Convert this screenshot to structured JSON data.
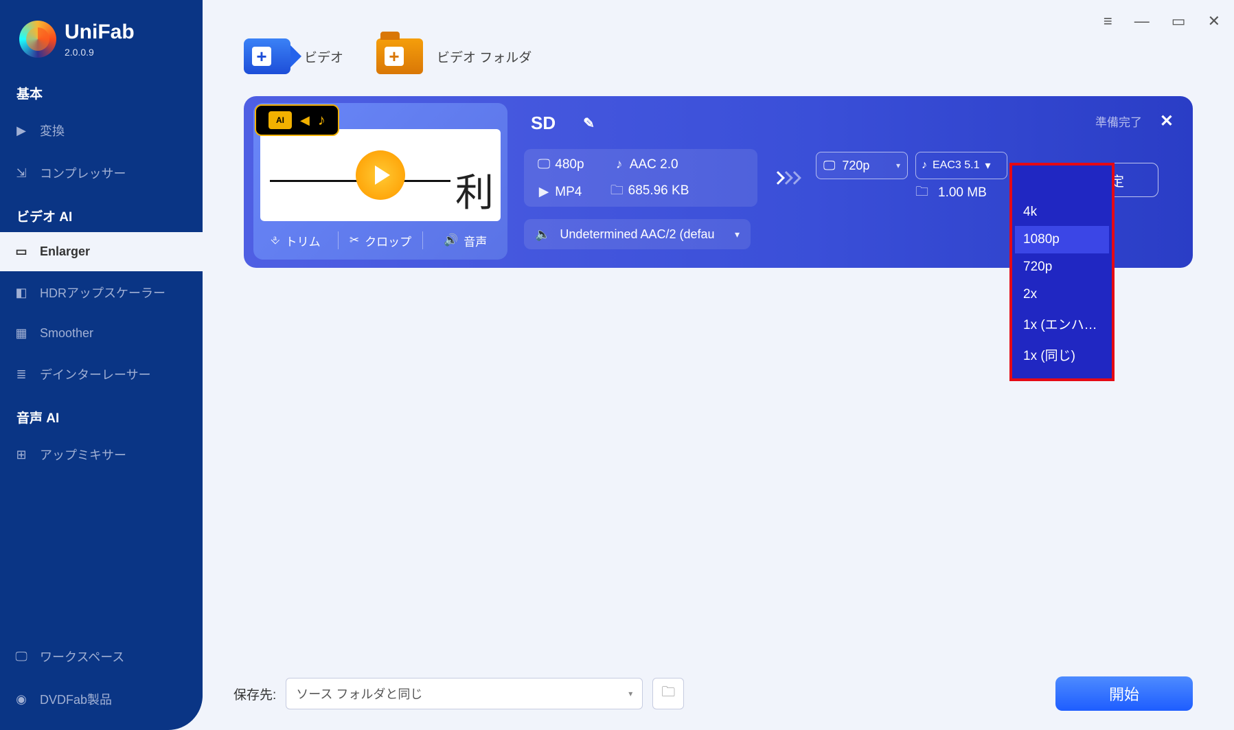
{
  "app": {
    "name": "UniFab",
    "version": "2.0.0.9"
  },
  "sidebar": {
    "basic_label": "基本",
    "basic": [
      {
        "label": "変換",
        "icon": "play-square"
      },
      {
        "label": "コンプレッサー",
        "icon": "compress"
      }
    ],
    "video_ai_label": "ビデオ AI",
    "video_ai": [
      {
        "label": "Enlarger",
        "icon": "enlarge"
      },
      {
        "label": "HDRアップスケーラー",
        "icon": "hdr"
      },
      {
        "label": "Smoother",
        "icon": "smoother"
      },
      {
        "label": "デインターレーサー",
        "icon": "deinterlace"
      }
    ],
    "audio_ai_label": "音声 AI",
    "audio_ai": [
      {
        "label": "アップミキサー",
        "icon": "upmix"
      }
    ],
    "bottom": [
      {
        "label": "ワークスペース",
        "icon": "workspace"
      },
      {
        "label": "DVDFab製品",
        "icon": "dvdfab"
      }
    ]
  },
  "addbar": {
    "video_label": "ビデオ",
    "folder_label": "ビデオ フォルダ"
  },
  "card": {
    "ai_badge": "AI",
    "tools": {
      "trim": "トリム",
      "crop": "クロップ",
      "audio": "音声"
    },
    "title": "SD",
    "status": "準備完了",
    "source": {
      "res": "480p",
      "audio": "AAC 2.0",
      "container": "MP4",
      "size": "685.96 KB"
    },
    "output": {
      "res_selected": "720p",
      "audio_selected": "EAC3 5.1",
      "size": "1.00 MB"
    },
    "audio_track": "Undetermined AAC/2 (defau",
    "settings_label": "設定",
    "res_options": [
      "4k",
      "1080p",
      "720p",
      "2x",
      "1x (エンハ…",
      "1x (同じ)"
    ]
  },
  "footer": {
    "dest_label": "保存先:",
    "dest_value": "ソース フォルダと同じ",
    "start_label": "開始"
  }
}
